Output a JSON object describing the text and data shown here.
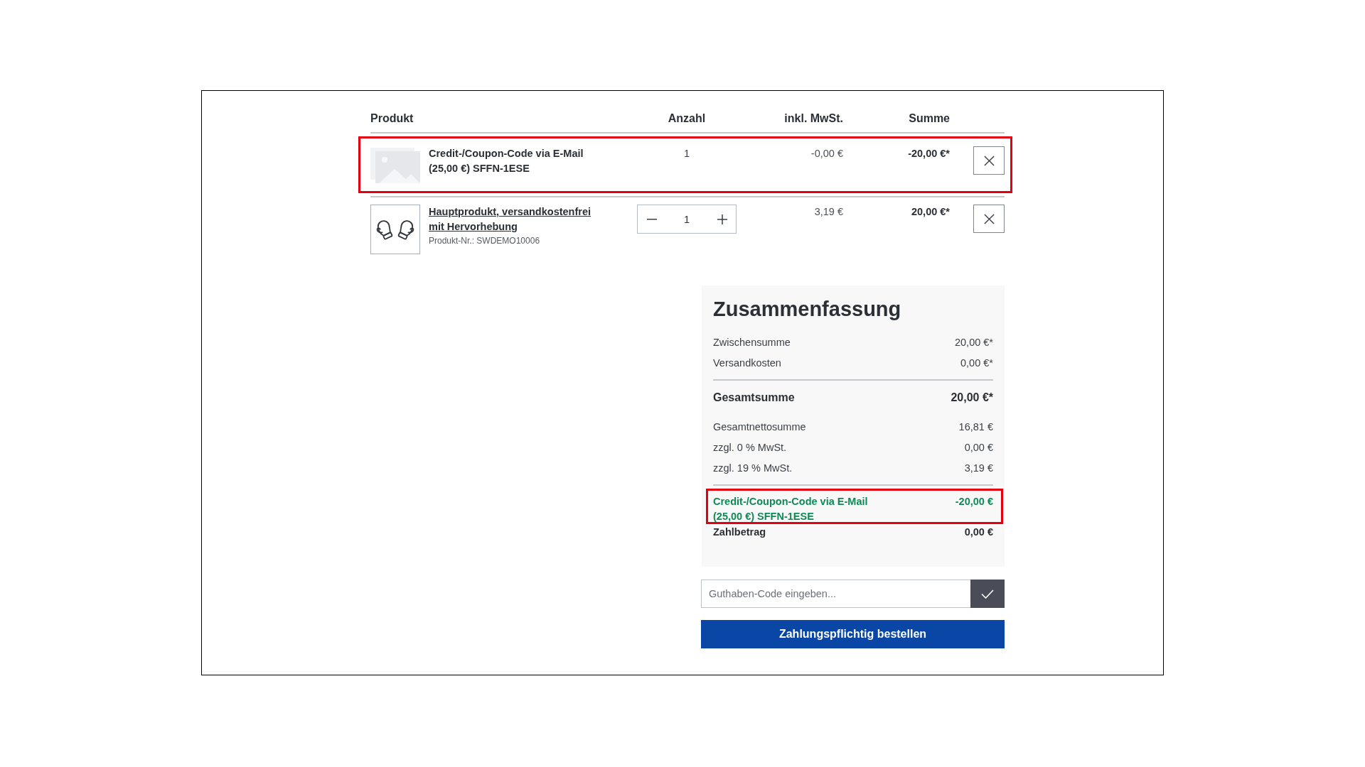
{
  "cart": {
    "columns": [
      "Produkt",
      "Anzahl",
      "inkl. MwSt.",
      "Summe"
    ],
    "items": [
      {
        "kind": "promotion",
        "highlighted": true,
        "name": "Credit-/Coupon-Code via E-Mail (25,00 €) SFFN-1ESE",
        "quantity": "1",
        "tax": "-0,00 €",
        "total": "-20,00 €*"
      },
      {
        "kind": "product",
        "highlighted": false,
        "name": "Hauptprodukt, versandkostenfrei mit Hervorhebung",
        "product_number": "Produkt-Nr.: SWDEMO10006",
        "quantity": "1",
        "tax": "3,19 €",
        "total": "20,00 €*"
      }
    ]
  },
  "summary": {
    "title": "Zusammenfassung",
    "sections": [
      {
        "rows": [
          {
            "kind": "regular",
            "highlighted": false,
            "label": "Zwischensumme",
            "value": "20,00 €*"
          },
          {
            "kind": "regular",
            "highlighted": false,
            "label": "Versandkosten",
            "value": "0,00 €*"
          }
        ]
      },
      {
        "rows": [
          {
            "kind": "grand_total",
            "highlighted": false,
            "label": "Gesamtsumme",
            "value": "20,00 €*"
          },
          {
            "kind": "regular",
            "highlighted": false,
            "label": "Gesamtnettosumme",
            "value": "16,81 €"
          },
          {
            "kind": "regular",
            "highlighted": false,
            "label": "zzgl. 0 % MwSt.",
            "value": "0,00 €"
          },
          {
            "kind": "regular",
            "highlighted": false,
            "label": "zzgl. 19 % MwSt.",
            "value": "3,19 €"
          }
        ]
      },
      {
        "rows": [
          {
            "kind": "discount",
            "highlighted": true,
            "label": "Credit-/Coupon-Code via E-Mail (25,00 €) SFFN-1ESE",
            "value": "-20,00 €"
          },
          {
            "kind": "payable",
            "highlighted": false,
            "label": "Zahlbetrag",
            "value": "0,00 €"
          }
        ]
      }
    ]
  },
  "voucher": {
    "placeholder": "Guthaben-Code eingeben..."
  },
  "order_button": "Zahlungspflichtig bestellen"
}
